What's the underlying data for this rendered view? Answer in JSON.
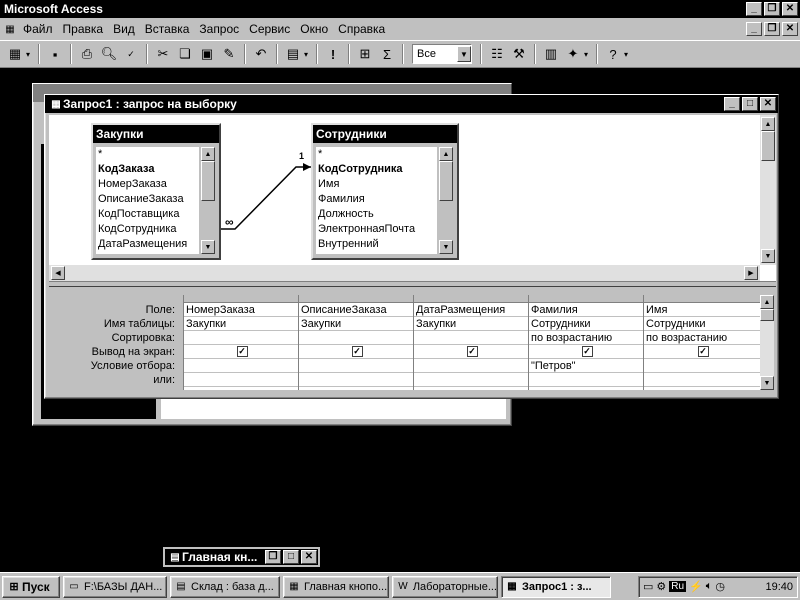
{
  "app": {
    "title": "Microsoft Access"
  },
  "menu": {
    "items": [
      "Файл",
      "Правка",
      "Вид",
      "Вставка",
      "Запрос",
      "Сервис",
      "Окно",
      "Справка"
    ]
  },
  "toolbar": {
    "combo_value": "Все",
    "icons": [
      "datasheet-view-icon",
      "save-icon",
      "print-icon",
      "print-preview-icon",
      "spelling-icon",
      "cut-icon",
      "copy-icon",
      "paste-icon",
      "format-painter-icon",
      "undo-icon",
      "query-type-icon",
      "run-icon",
      "show-table-icon",
      "totals-icon",
      "properties-icon",
      "build-icon",
      "database-window-icon",
      "new-object-icon",
      "help-icon"
    ]
  },
  "query_window": {
    "title": "Запрос1 : запрос на выборку",
    "tables": [
      {
        "name": "Закупки",
        "fields": [
          "*",
          "КодЗаказа",
          "НомерЗаказа",
          "ОписаниеЗаказа",
          "КодПоставщика",
          "КодСотрудника",
          "ДатаРазмещения"
        ],
        "key_field": "КодЗаказа"
      },
      {
        "name": "Сотрудники",
        "fields": [
          "*",
          "КодСотрудника",
          "Имя",
          "Фамилия",
          "Должность",
          "ЭлектроннаяПочта",
          "Внутренний"
        ],
        "key_field": "КодСотрудника"
      }
    ],
    "relationship": {
      "one_label": "1",
      "many_label": "∞"
    },
    "grid": {
      "row_labels": [
        "Поле:",
        "Имя таблицы:",
        "Сортировка:",
        "Вывод на экран:",
        "Условие отбора:",
        "или:"
      ],
      "columns": [
        {
          "field": "НомерЗаказа",
          "table": "Закупки",
          "sort": "",
          "show": true,
          "criteria": ""
        },
        {
          "field": "ОписаниеЗаказа",
          "table": "Закупки",
          "sort": "",
          "show": true,
          "criteria": ""
        },
        {
          "field": "ДатаРазмещения",
          "table": "Закупки",
          "sort": "",
          "show": true,
          "criteria": ""
        },
        {
          "field": "Фамилия",
          "table": "Сотрудники",
          "sort": "по возрастанию",
          "show": true,
          "criteria": "\"Петров\""
        },
        {
          "field": "Имя",
          "table": "Сотрудники",
          "sort": "по возрастанию",
          "show": true,
          "criteria": ""
        }
      ]
    }
  },
  "minimized_window": {
    "title": "Главная кн..."
  },
  "taskbar": {
    "start_label": "Пуск",
    "tasks": [
      {
        "label": "F:\\БАЗЫ ДАН...",
        "icon": "folder-icon",
        "active": false
      },
      {
        "label": "Склад : база д...",
        "icon": "database-icon",
        "active": false
      },
      {
        "label": "Главная кнопо...",
        "icon": "form-icon",
        "active": false
      },
      {
        "label": "Лабораторные...",
        "icon": "word-icon",
        "active": false
      },
      {
        "label": "Запрос1 : з...",
        "icon": "query-icon",
        "active": true
      }
    ],
    "tray": {
      "lang": "Ru",
      "clock": "19:40"
    }
  }
}
